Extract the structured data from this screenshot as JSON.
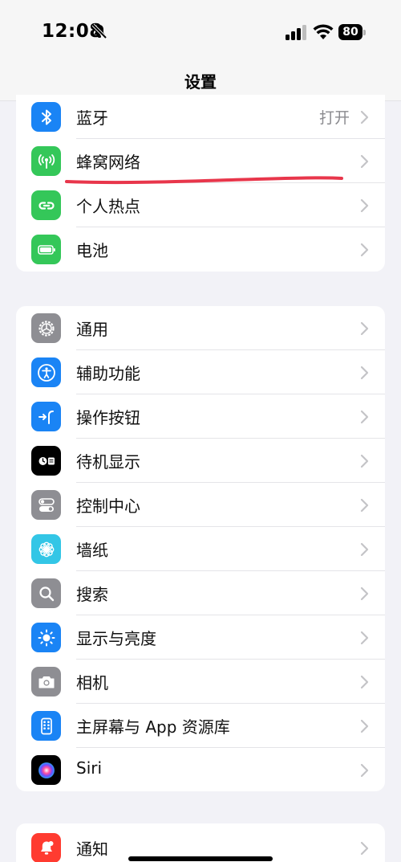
{
  "status_bar": {
    "time": "12:08",
    "battery_level": "80"
  },
  "nav": {
    "title": "设置"
  },
  "colors": {
    "blue": "#1a84f5",
    "green": "#34c759",
    "gray": "#8e8e93",
    "black": "#000000",
    "teal": "#33c6e6",
    "red": "#ff3b30",
    "annotation": "#e8364b"
  },
  "groups": [
    {
      "items": [
        {
          "label": "蓝牙",
          "value": "打开",
          "icon": "bluetooth-icon",
          "icon_color": "#1a84f5"
        },
        {
          "label": "蜂窝网络",
          "icon": "cellular-icon",
          "icon_color": "#34c759"
        },
        {
          "label": "个人热点",
          "icon": "hotspot-icon",
          "icon_color": "#34c759"
        },
        {
          "label": "电池",
          "icon": "battery-icon",
          "icon_color": "#34c759"
        }
      ]
    },
    {
      "items": [
        {
          "label": "通用",
          "icon": "gear-icon",
          "icon_color": "#8e8e93"
        },
        {
          "label": "辅助功能",
          "icon": "accessibility-icon",
          "icon_color": "#1a84f5"
        },
        {
          "label": "操作按钮",
          "icon": "action-button-icon",
          "icon_color": "#1a84f5"
        },
        {
          "label": "待机显示",
          "icon": "standby-icon",
          "icon_color": "#000000"
        },
        {
          "label": "控制中心",
          "icon": "control-center-icon",
          "icon_color": "#8e8e93"
        },
        {
          "label": "墙纸",
          "icon": "wallpaper-flower-icon",
          "icon_color": "#33c6e6"
        },
        {
          "label": "搜索",
          "icon": "search-icon",
          "icon_color": "#8e8e93"
        },
        {
          "label": "显示与亮度",
          "icon": "brightness-sun-icon",
          "icon_color": "#1a84f5"
        },
        {
          "label": "相机",
          "icon": "camera-icon",
          "icon_color": "#8e8e93"
        },
        {
          "label": "主屏幕与 App 资源库",
          "icon": "home-screen-icon",
          "icon_color": "#1a84f5"
        },
        {
          "label": "Siri",
          "icon": "siri-icon",
          "icon_color": "#000000"
        }
      ]
    },
    {
      "items": [
        {
          "label": "通知",
          "icon": "notification-bell-icon",
          "icon_color": "#ff3b30"
        }
      ]
    }
  ]
}
